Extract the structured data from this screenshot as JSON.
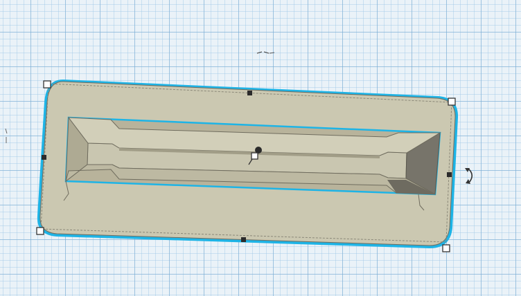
{
  "workplane": {
    "grid": "on"
  },
  "colors": {
    "workplane_bg": "#eaf2f8",
    "grid_line": "#9cc3e0",
    "selection_outline": "#1eb4e6",
    "shape_fill": "#cbc8b1",
    "shape_shade": "#b3ae95",
    "shape_dark": "#8d8a78",
    "handle_fill": "#ffffff",
    "handle_stroke": "#333333",
    "handle_dark": "#2b2b2b"
  },
  "icons": {
    "rotate": "rotate-arrows-icon",
    "height_handle": "lift-handle-icon"
  }
}
